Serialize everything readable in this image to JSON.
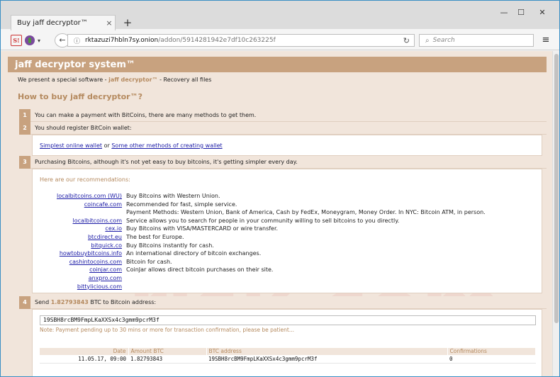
{
  "browser": {
    "tab_title": "Buy jaff decryptor™",
    "tab_close": "×",
    "new_tab": "+",
    "minimize": "—",
    "maximize": "☐",
    "close": "✕",
    "s_icon": "S!",
    "caret": "▾",
    "back": "←",
    "url_host": "rktazuzi7hbln7sy.onion",
    "url_path": "/addon/5914281942e7df10c263225f",
    "search_placeholder": "Search",
    "menu": "≡"
  },
  "page": {
    "title": "jaff decryptor system™",
    "intro_pre": "We present a special software - ",
    "intro_brand": "jaff decryptor™",
    "intro_post": " - Recovery all files",
    "howto": "How to buy jaff decryptor™?",
    "steps": [
      {
        "num": "1",
        "text": "You can make a payment with BitCoins, there are many methods to get them."
      },
      {
        "num": "2",
        "text": "You should register BitCoin wallet:"
      },
      {
        "num": "3",
        "text": "Purchasing Bitcoins, although it's not yet easy to buy bitcoins, it's getting simpler every day."
      },
      {
        "num": "4",
        "text_pre": "Send ",
        "amount": "1.82793843",
        "text_post": " BTC to Bitcoin address:"
      }
    ],
    "wallet_link1": "Simplest online wallet",
    "wallet_or": " or ",
    "wallet_link2": "Some other methods of creating wallet",
    "rec_head": "Here are our recommendations:",
    "recommendations": [
      {
        "link": "localbitcoins.com (WU)",
        "desc": "Buy Bitcoins with Western Union."
      },
      {
        "link": "coincafe.com",
        "desc": "Recommended for fast, simple service."
      },
      {
        "link": "",
        "desc": "Payment Methods: Western Union, Bank of America, Cash by FedEx, Moneygram, Money Order. In NYC: Bitcoin ATM, in person."
      },
      {
        "link": "localbitcoins.com",
        "desc": "Service allows you to search for people in your community willing to sell bitcoins to you directly."
      },
      {
        "link": "cex.io",
        "desc": "Buy Bitcoins with VISA/MASTERCARD or wire transfer."
      },
      {
        "link": "btcdirect.eu",
        "desc": "The best for Europe."
      },
      {
        "link": "bitquick.co",
        "desc": "Buy Bitcoins instantly for cash."
      },
      {
        "link": "howtobuybitcoins.info",
        "desc": "An international directory of bitcoin exchanges."
      },
      {
        "link": "cashintocoins.com",
        "desc": "Bitcoin for cash."
      },
      {
        "link": "coinjar.com",
        "desc": "CoinJar allows direct bitcoin purchases on their site."
      },
      {
        "link": "anxpro.com",
        "desc": ""
      },
      {
        "link": "bittylicious.com",
        "desc": ""
      }
    ],
    "btc_address": "19SBH8rcBM9FmpLKaXXSx4c3gmm9pcrM3f",
    "note": "Note: Payment pending up to 30 mins or more for transaction confirmation, please be patient...",
    "tx_headers": [
      "Date",
      "Amount BTC",
      "BTC address",
      "Confirmations"
    ],
    "tx_rows": [
      [
        "11.05.17, 09:00",
        "1.82793843",
        "19SBH8rcBM9FmpLKaXXSx4c3gmm9pcrM3f",
        "0"
      ]
    ]
  },
  "icons": {
    "info": "ⓘ",
    "reload": "↻",
    "search": "⌕"
  },
  "colors": {
    "accent": "#c8a27f",
    "accent_text": "#b58a5f",
    "page_bg": "#f1e5db",
    "link": "#1a1aa6"
  }
}
